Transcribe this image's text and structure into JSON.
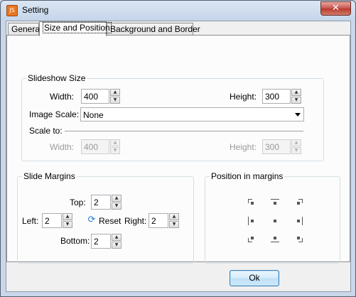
{
  "window": {
    "title": "Setting",
    "close_glyph": "✕"
  },
  "tabs": [
    {
      "label": "General"
    },
    {
      "label": "Size and Position"
    },
    {
      "label": "Background and Border"
    }
  ],
  "slideshow_size": {
    "title": "Slideshow Size",
    "width_label": "Width:",
    "width_value": "400",
    "height_label": "Height:",
    "height_value": "300",
    "image_scale_label": "Image Scale:",
    "image_scale_value": "None",
    "scale_to_label": "Scale to:",
    "scale_width_label": "Width:",
    "scale_width_value": "400",
    "scale_height_label": "Height:",
    "scale_height_value": "300"
  },
  "slide_margins": {
    "title": "Slide Margins",
    "top_label": "Top:",
    "top_value": "2",
    "left_label": "Left:",
    "left_value": "2",
    "reset_label": "Reset",
    "right_label": "Right:",
    "right_value": "2",
    "bottom_label": "Bottom:",
    "bottom_value": "2"
  },
  "position_in_margins": {
    "title": "Position in margins"
  },
  "footer": {
    "ok_label": "Ok"
  }
}
